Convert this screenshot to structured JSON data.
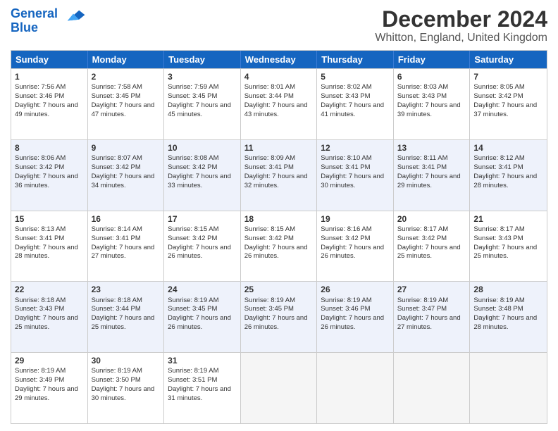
{
  "logo": {
    "line1": "General",
    "line2": "Blue"
  },
  "title": "December 2024",
  "subtitle": "Whitton, England, United Kingdom",
  "days": [
    "Sunday",
    "Monday",
    "Tuesday",
    "Wednesday",
    "Thursday",
    "Friday",
    "Saturday"
  ],
  "rows": [
    [
      {
        "day": null,
        "empty": true
      },
      {
        "day": null,
        "empty": true
      },
      {
        "day": null,
        "empty": true
      },
      {
        "day": null,
        "empty": true
      },
      {
        "day": null,
        "empty": true
      },
      {
        "day": null,
        "empty": true
      },
      {
        "day": null,
        "empty": true
      }
    ],
    [
      {
        "num": "1",
        "rise": "Sunrise: 7:56 AM",
        "set": "Sunset: 3:46 PM",
        "daylight": "Daylight: 7 hours and 49 minutes."
      },
      {
        "num": "2",
        "rise": "Sunrise: 7:58 AM",
        "set": "Sunset: 3:45 PM",
        "daylight": "Daylight: 7 hours and 47 minutes."
      },
      {
        "num": "3",
        "rise": "Sunrise: 7:59 AM",
        "set": "Sunset: 3:45 PM",
        "daylight": "Daylight: 7 hours and 45 minutes."
      },
      {
        "num": "4",
        "rise": "Sunrise: 8:01 AM",
        "set": "Sunset: 3:44 PM",
        "daylight": "Daylight: 7 hours and 43 minutes."
      },
      {
        "num": "5",
        "rise": "Sunrise: 8:02 AM",
        "set": "Sunset: 3:43 PM",
        "daylight": "Daylight: 7 hours and 41 minutes."
      },
      {
        "num": "6",
        "rise": "Sunrise: 8:03 AM",
        "set": "Sunset: 3:43 PM",
        "daylight": "Daylight: 7 hours and 39 minutes."
      },
      {
        "num": "7",
        "rise": "Sunrise: 8:05 AM",
        "set": "Sunset: 3:42 PM",
        "daylight": "Daylight: 7 hours and 37 minutes."
      }
    ],
    [
      {
        "num": "8",
        "rise": "Sunrise: 8:06 AM",
        "set": "Sunset: 3:42 PM",
        "daylight": "Daylight: 7 hours and 36 minutes."
      },
      {
        "num": "9",
        "rise": "Sunrise: 8:07 AM",
        "set": "Sunset: 3:42 PM",
        "daylight": "Daylight: 7 hours and 34 minutes."
      },
      {
        "num": "10",
        "rise": "Sunrise: 8:08 AM",
        "set": "Sunset: 3:42 PM",
        "daylight": "Daylight: 7 hours and 33 minutes."
      },
      {
        "num": "11",
        "rise": "Sunrise: 8:09 AM",
        "set": "Sunset: 3:41 PM",
        "daylight": "Daylight: 7 hours and 32 minutes."
      },
      {
        "num": "12",
        "rise": "Sunrise: 8:10 AM",
        "set": "Sunset: 3:41 PM",
        "daylight": "Daylight: 7 hours and 30 minutes."
      },
      {
        "num": "13",
        "rise": "Sunrise: 8:11 AM",
        "set": "Sunset: 3:41 PM",
        "daylight": "Daylight: 7 hours and 29 minutes."
      },
      {
        "num": "14",
        "rise": "Sunrise: 8:12 AM",
        "set": "Sunset: 3:41 PM",
        "daylight": "Daylight: 7 hours and 28 minutes."
      }
    ],
    [
      {
        "num": "15",
        "rise": "Sunrise: 8:13 AM",
        "set": "Sunset: 3:41 PM",
        "daylight": "Daylight: 7 hours and 28 minutes."
      },
      {
        "num": "16",
        "rise": "Sunrise: 8:14 AM",
        "set": "Sunset: 3:41 PM",
        "daylight": "Daylight: 7 hours and 27 minutes."
      },
      {
        "num": "17",
        "rise": "Sunrise: 8:15 AM",
        "set": "Sunset: 3:42 PM",
        "daylight": "Daylight: 7 hours and 26 minutes."
      },
      {
        "num": "18",
        "rise": "Sunrise: 8:15 AM",
        "set": "Sunset: 3:42 PM",
        "daylight": "Daylight: 7 hours and 26 minutes."
      },
      {
        "num": "19",
        "rise": "Sunrise: 8:16 AM",
        "set": "Sunset: 3:42 PM",
        "daylight": "Daylight: 7 hours and 26 minutes."
      },
      {
        "num": "20",
        "rise": "Sunrise: 8:17 AM",
        "set": "Sunset: 3:42 PM",
        "daylight": "Daylight: 7 hours and 25 minutes."
      },
      {
        "num": "21",
        "rise": "Sunrise: 8:17 AM",
        "set": "Sunset: 3:43 PM",
        "daylight": "Daylight: 7 hours and 25 minutes."
      }
    ],
    [
      {
        "num": "22",
        "rise": "Sunrise: 8:18 AM",
        "set": "Sunset: 3:43 PM",
        "daylight": "Daylight: 7 hours and 25 minutes."
      },
      {
        "num": "23",
        "rise": "Sunrise: 8:18 AM",
        "set": "Sunset: 3:44 PM",
        "daylight": "Daylight: 7 hours and 25 minutes."
      },
      {
        "num": "24",
        "rise": "Sunrise: 8:19 AM",
        "set": "Sunset: 3:45 PM",
        "daylight": "Daylight: 7 hours and 26 minutes."
      },
      {
        "num": "25",
        "rise": "Sunrise: 8:19 AM",
        "set": "Sunset: 3:45 PM",
        "daylight": "Daylight: 7 hours and 26 minutes."
      },
      {
        "num": "26",
        "rise": "Sunrise: 8:19 AM",
        "set": "Sunset: 3:46 PM",
        "daylight": "Daylight: 7 hours and 26 minutes."
      },
      {
        "num": "27",
        "rise": "Sunrise: 8:19 AM",
        "set": "Sunset: 3:47 PM",
        "daylight": "Daylight: 7 hours and 27 minutes."
      },
      {
        "num": "28",
        "rise": "Sunrise: 8:19 AM",
        "set": "Sunset: 3:48 PM",
        "daylight": "Daylight: 7 hours and 28 minutes."
      }
    ],
    [
      {
        "num": "29",
        "rise": "Sunrise: 8:19 AM",
        "set": "Sunset: 3:49 PM",
        "daylight": "Daylight: 7 hours and 29 minutes."
      },
      {
        "num": "30",
        "rise": "Sunrise: 8:19 AM",
        "set": "Sunset: 3:50 PM",
        "daylight": "Daylight: 7 hours and 30 minutes."
      },
      {
        "num": "31",
        "rise": "Sunrise: 8:19 AM",
        "set": "Sunset: 3:51 PM",
        "daylight": "Daylight: 7 hours and 31 minutes."
      },
      {
        "day": null,
        "empty": true
      },
      {
        "day": null,
        "empty": true
      },
      {
        "day": null,
        "empty": true
      },
      {
        "day": null,
        "empty": true
      }
    ]
  ]
}
